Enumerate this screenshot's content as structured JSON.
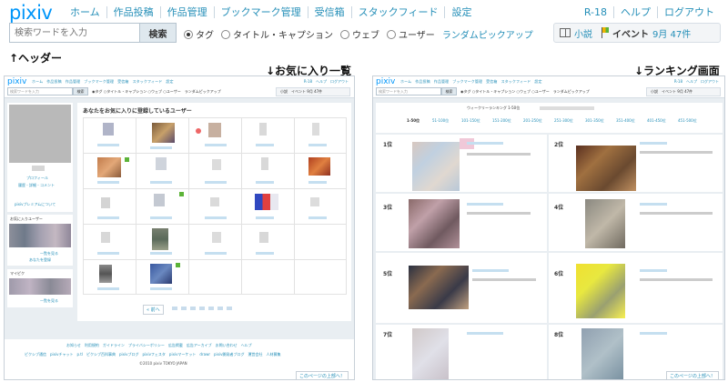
{
  "header": {
    "logo": "pixiv",
    "nav": [
      "ホーム",
      "作品投稿",
      "作品管理",
      "ブックマーク管理",
      "受信箱",
      "スタックフィード",
      "設定"
    ],
    "nav_right": [
      "R-18",
      "ヘルプ",
      "ログアウト"
    ],
    "search_placeholder": "検索ワードを入力",
    "search_button": "検索",
    "search_options": [
      "タグ",
      "タイトル・キャプション",
      "ウェブ",
      "ユーザー"
    ],
    "selected_option": "タグ",
    "random_pickup": "ランダムピックアップ",
    "widget": {
      "novel": "小説",
      "event": "イベント",
      "event_date": "9月 47件"
    }
  },
  "labels": {
    "header_label": "↑ヘッダー",
    "favorites_label": "↓お気に入り一覧",
    "ranking_label": "↓ランキング画面"
  },
  "favorites_panel": {
    "mini_nav": "ホーム　作品投稿　作品管理　ブックマーク管理　受信箱　スタックフィード　設定",
    "mini_nav_right": "R-18　ヘルプ　ログアウト",
    "mini_search_placeholder": "検索ワードを入力",
    "mini_search_button": "検索",
    "mini_options": "◉タグ ○タイトル・キャプション ○ウェブ ○ユーザー　ランダムピックアップ",
    "mini_widget": "小説　イベント 9月 47件",
    "title": "あなたをお気に入りに登録しているユーザー",
    "profile_link": "プロフィール",
    "profile_sub": "履歴 - 詳細 - コメント",
    "premium": "pixivプレミアムについて",
    "fav_users_heading": "お気に入りユーザー",
    "list_link": "一覧を見る",
    "you_registered": "あなたを登録",
    "mypick_heading": "マイピク",
    "mypick_list": "一覧を見る",
    "next_button": "« 前へ",
    "footer_links_1": "お知らせ　利用規約　ガイドライン　プライバシーポリシー　広告掲載　広告アーカイブ　お問い合わせ　ヘルプ",
    "footer_links_2": "ピクシブ通信　pixivチャット　p.tl　ピクシブ百科事典　pixivブログ　pixivフェスタ　pixivマーケット　drawr　pixiv開発者ブログ　運営会社　人材募集",
    "copyright": "©2010 pixiv TOKYO JAPAN",
    "back_top": "このページの上部へ！"
  },
  "ranking_panel": {
    "mini_nav": "ホーム　作品投稿　作品管理　ブックマーク管理　受信箱　スタックフィード　設定",
    "mini_nav_right": "R-18　ヘルプ　ログアウト",
    "mini_search_placeholder": "検索ワードを入力",
    "mini_search_button": "検索",
    "mini_options": "◉タグ ○タイトル・キャプション ○ウェブ ○ユーザー　ランダムピックアップ",
    "mini_widget": "小説　イベント 9月 47件",
    "title": "ウィークリーランキング 1-50位",
    "tabs": [
      "1-50位",
      "51-100位",
      "101-150位",
      "151-200位",
      "201-250位",
      "251-300位",
      "301-350位",
      "351-400位",
      "401-450位",
      "451-500位"
    ],
    "ranks": [
      "1位",
      "2位",
      "3位",
      "4位",
      "5位",
      "6位",
      "7位",
      "8位"
    ],
    "back_top": "このページの上部へ！"
  },
  "colors": {
    "brand": "#0096fa",
    "link": "#258fb8",
    "panel_bg": "#e9eef2"
  }
}
